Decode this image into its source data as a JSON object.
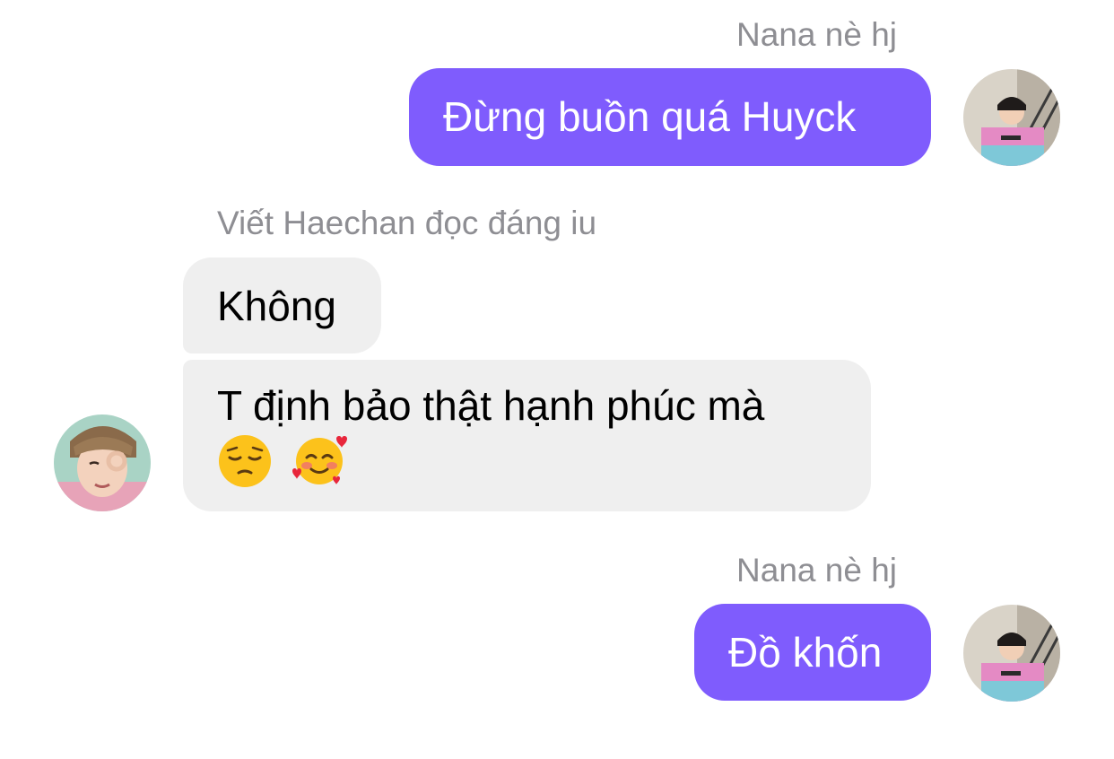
{
  "messages": [
    {
      "sender": "Nana nè hj",
      "text": "Đừng buồn quá Huyck"
    },
    {
      "sender": "Viết Haechan đọc đáng iu",
      "text": "Không"
    },
    {
      "text": "T định bảo thật hạnh phúc mà",
      "emojis": [
        "pensive-face-icon",
        "smiling-face-with-hearts-icon"
      ]
    },
    {
      "sender": "Nana nè hj",
      "text": "Đồ khốn"
    }
  ],
  "colors": {
    "outgoing_bubble": "#7f5cfd",
    "incoming_bubble": "#efefef",
    "sender_name": "#8e8e93"
  }
}
